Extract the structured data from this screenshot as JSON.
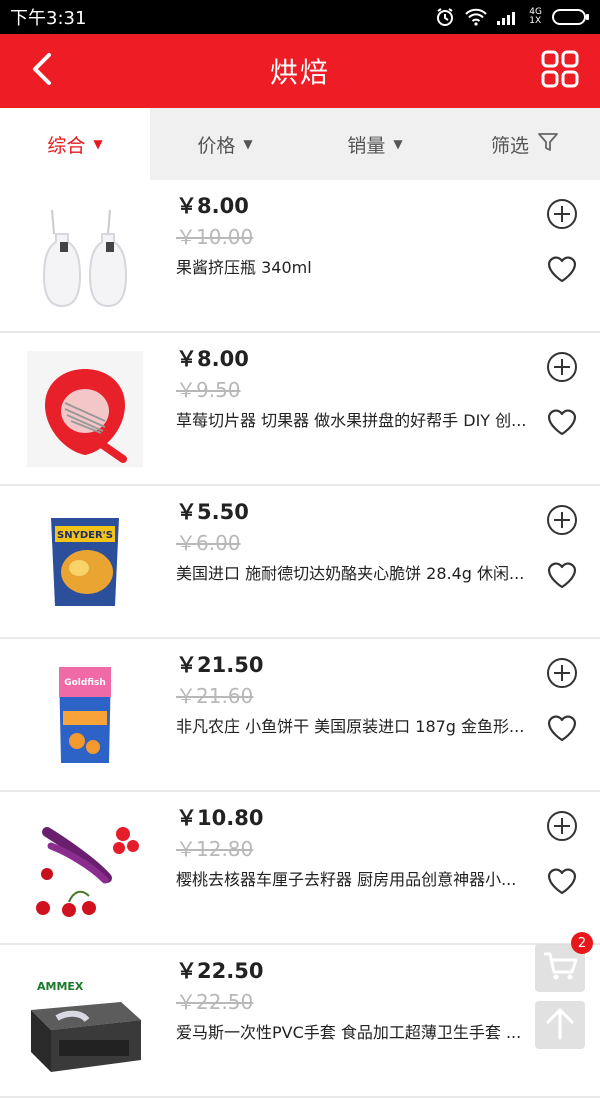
{
  "status": {
    "time": "下午3:31",
    "network_top": "4G",
    "network_bottom": "1X"
  },
  "header": {
    "title": "烘焙",
    "back_icon": "chevron-left-icon",
    "grid_icon": "grid-icon"
  },
  "sort_tabs": [
    {
      "label": "综合",
      "icon": "triangle-down-icon",
      "active": true
    },
    {
      "label": "价格",
      "icon": "triangle-down-icon",
      "active": false
    },
    {
      "label": "销量",
      "icon": "triangle-down-icon",
      "active": false
    },
    {
      "label": "筛选",
      "icon": "filter-icon",
      "active": false
    }
  ],
  "products": [
    {
      "price": "￥8.00",
      "old_price": "￥10.00",
      "name": "果酱挤压瓶  340ml"
    },
    {
      "price": "￥8.00",
      "old_price": "￥9.50",
      "name": "草莓切片器 切果器 做水果拼盘的好帮手 DIY 创..."
    },
    {
      "price": "￥5.50",
      "old_price": "￥6.00",
      "name": "美国进口 施耐德切达奶酪夹心脆饼 28.4g 休闲..."
    },
    {
      "price": "￥21.50",
      "old_price": "￥21.60",
      "name": "非凡农庄 小鱼饼干 美国原装进口 187g 金鱼形..."
    },
    {
      "price": "￥10.80",
      "old_price": "￥12.80",
      "name": "樱桃去核器车厘子去籽器 厨房用品创意神器小..."
    },
    {
      "price": "￥22.50",
      "old_price": "￥22.50",
      "name": "爱马斯一次性PVC手套  食品加工超薄卫生手套 ..."
    }
  ],
  "product_image_text": {
    "p3": "SNYDER'S",
    "p4": "Goldfish",
    "p6": "AMMEX"
  },
  "cart": {
    "badge": "2",
    "icon": "cart-icon"
  },
  "back_to_top_icon": "arrow-up-icon",
  "colors": {
    "brand_red": "#ee1c25",
    "active_tab_red": "#e8171c",
    "strike_gray": "#b8b8b8"
  }
}
